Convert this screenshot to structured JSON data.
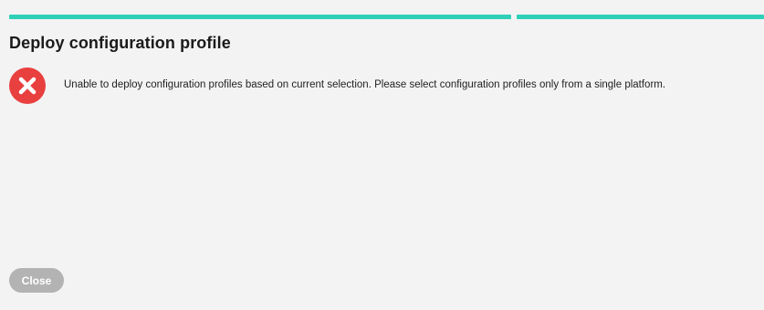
{
  "progress": {
    "segments": 2,
    "color": "#2fd0b8"
  },
  "dialog": {
    "title": "Deploy configuration profile",
    "message": "Unable to deploy configuration profiles based on current selection. Please select configuration profiles only from a single platform.",
    "icon": "error-x-icon",
    "icon_color": "#e8403f"
  },
  "footer": {
    "close_label": "Close",
    "close_color": "#b3b3b3"
  },
  "theme": {
    "background": "#f3f3f3"
  }
}
